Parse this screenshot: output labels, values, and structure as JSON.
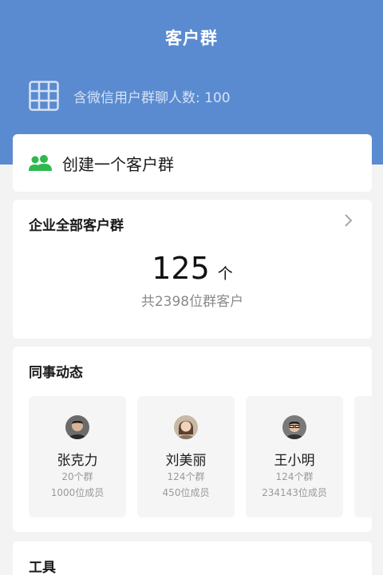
{
  "header": {
    "title": "客户群",
    "limit_text": "含微信用户群聊人数: 100",
    "color": "#5a8bd0"
  },
  "create": {
    "label": "创建一个客户群",
    "icon_color": "#2eb84d"
  },
  "all_groups": {
    "title": "企业全部客户群",
    "count": "125",
    "unit": "个",
    "subtitle": "共2398位群客户"
  },
  "colleagues": {
    "title": "同事动态",
    "items": [
      {
        "name": "张克力",
        "groups": "20个群",
        "members": "1000位成员"
      },
      {
        "name": "刘美丽",
        "groups": "124个群",
        "members": "450位成员"
      },
      {
        "name": "王小明",
        "groups": "124个群",
        "members": "234143位成员"
      }
    ]
  },
  "tools": {
    "title": "工具"
  }
}
